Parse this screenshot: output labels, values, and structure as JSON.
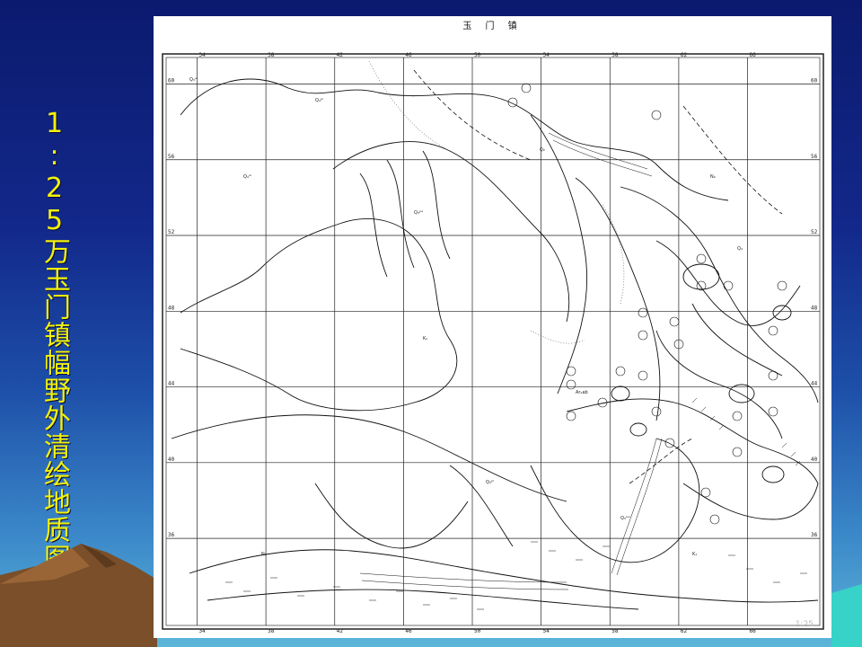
{
  "slide": {
    "title": "1:25万玉门镇幅野外清绘地质图",
    "bg_top": "#0b1a6e",
    "bg_bottom": "#5bb6d8",
    "title_color": "#f2f20a"
  },
  "map": {
    "sheet_name": "玉 门 镇",
    "top_ticks": [
      "34",
      "38",
      "42",
      "46",
      "50",
      "54",
      "58",
      "62",
      "66"
    ],
    "bottom_ticks": [
      "34",
      "38",
      "42",
      "46",
      "50",
      "54",
      "58",
      "62",
      "66"
    ],
    "left_ticks": [
      "60",
      "56",
      "52",
      "48",
      "44",
      "40",
      "36"
    ],
    "right_ticks": [
      "60",
      "56",
      "52",
      "48",
      "44",
      "40",
      "36"
    ],
    "unit_labels": [
      "Q₃ᵃˡ",
      "Q₄ᵖˡ",
      "Q₄ᵃˡ",
      "Q₃ᵖᵃ",
      "Q₂",
      "N₂",
      "K₁",
      "Ar₂ab",
      "Q₃ᵖˡ",
      "N₂",
      "K₁",
      "Q₄",
      "Q₃ᵉᵒˡ"
    ],
    "corner_marks": [
      "1:25"
    ]
  }
}
